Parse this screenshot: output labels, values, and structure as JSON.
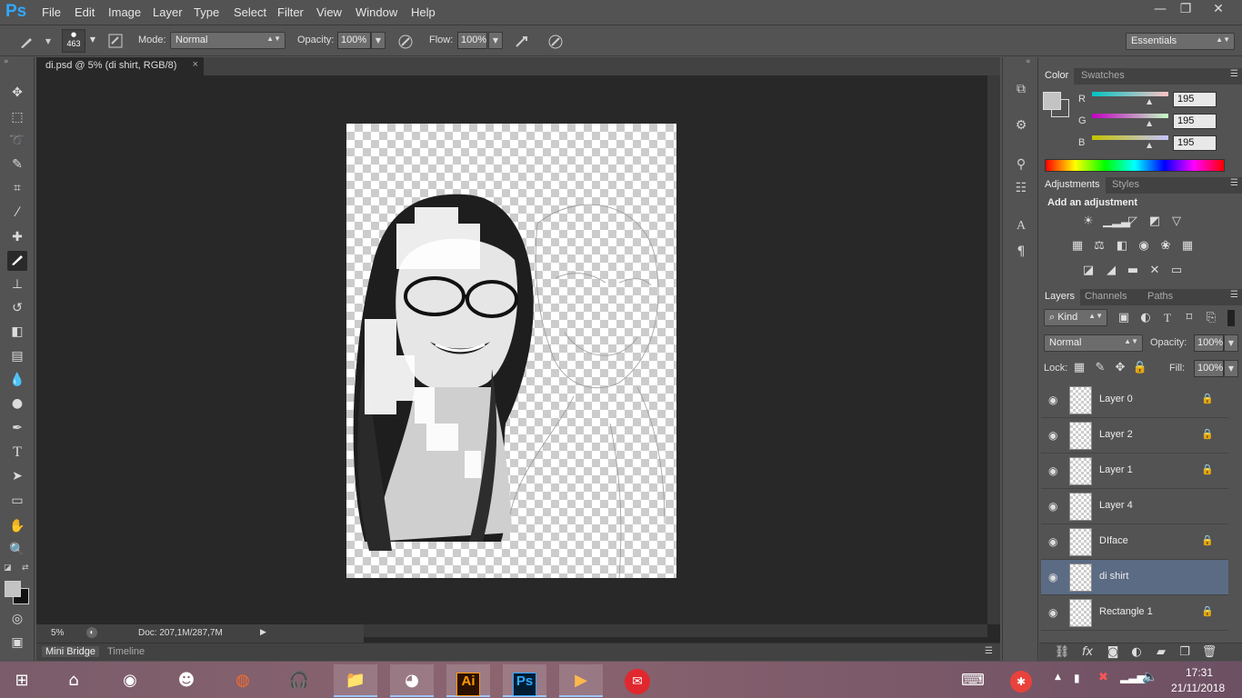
{
  "app": {
    "logo": "Ps"
  },
  "menu": [
    "File",
    "Edit",
    "Image",
    "Layer",
    "Type",
    "Select",
    "Filter",
    "View",
    "Window",
    "Help"
  ],
  "window_controls": {
    "minimize": "—",
    "restore": "❐",
    "close": "✕"
  },
  "options": {
    "brush_size": "463",
    "mode_label": "Mode:",
    "mode_value": "Normal",
    "opacity_label": "Opacity:",
    "opacity_value": "100%",
    "flow_label": "Flow:",
    "flow_value": "100%",
    "workspace": "Essentials"
  },
  "document": {
    "tab_title": "di.psd @ 5% (di shirt, RGB/8)",
    "tab_close": "×",
    "zoom": "5%",
    "doc_info": "Doc: 207,1M/287,7M"
  },
  "bottom_tabs": [
    "Mini Bridge",
    "Timeline"
  ],
  "color_panel": {
    "tabs": [
      "Color",
      "Swatches"
    ],
    "channels": [
      {
        "label": "R",
        "value": "195",
        "color": "#c3c3c3"
      },
      {
        "label": "G",
        "value": "195",
        "color": "#c3c3c3"
      },
      {
        "label": "B",
        "value": "195",
        "color": "#c3c3c3"
      }
    ],
    "foreground": "#c3c3c3"
  },
  "adjustments_panel": {
    "tabs": [
      "Adjustments",
      "Styles"
    ],
    "heading": "Add an adjustment"
  },
  "layers_panel": {
    "tabs": [
      "Layers",
      "Channels",
      "Paths"
    ],
    "filter_kind": "Kind",
    "blend_mode": "Normal",
    "opacity_label": "Opacity:",
    "opacity_value": "100%",
    "lock_label": "Lock:",
    "fill_label": "Fill:",
    "fill_value": "100%",
    "layers": [
      {
        "name": "Layer 0",
        "locked": true,
        "selected": false
      },
      {
        "name": "Layer 2",
        "locked": true,
        "selected": false
      },
      {
        "name": "Layer 1",
        "locked": true,
        "selected": false
      },
      {
        "name": "Layer 4",
        "locked": false,
        "selected": false
      },
      {
        "name": "DIface",
        "locked": true,
        "selected": false
      },
      {
        "name": "di shirt",
        "locked": false,
        "selected": true
      },
      {
        "name": "Rectangle 1",
        "locked": true,
        "selected": false
      }
    ]
  },
  "taskbar": {
    "time": "17:31",
    "date": "21/11/2018",
    "apps": [
      "windows-start",
      "home",
      "steam",
      "discord",
      "origin",
      "teamspeak",
      "file-explorer",
      "chrome",
      "illustrator",
      "photoshop",
      "media-player",
      "mail"
    ],
    "ai_label": "Ai",
    "ps_label": "Ps"
  }
}
